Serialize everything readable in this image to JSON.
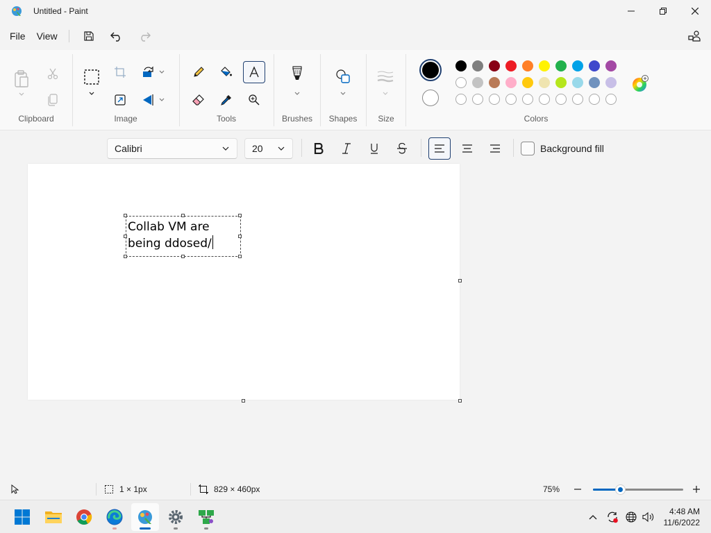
{
  "window": {
    "title": "Untitled - Paint"
  },
  "menu": {
    "file": "File",
    "view": "View"
  },
  "ribbon": {
    "groups": {
      "clipboard": "Clipboard",
      "image": "Image",
      "tools": "Tools",
      "brushes": "Brushes",
      "shapes": "Shapes",
      "size": "Size",
      "colors": "Colors"
    },
    "palette": {
      "row1": [
        "#000000",
        "#7f7f7f",
        "#880015",
        "#ed1c24",
        "#ff7f27",
        "#fff200",
        "#22b14c",
        "#00a2e8",
        "#3f48cc",
        "#a349a4"
      ],
      "row2": [
        "#ffffff",
        "#c3c3c3",
        "#b97a57",
        "#ffaec9",
        "#ffc90e",
        "#efe4b0",
        "#b5e61d",
        "#99d9ea",
        "#7092be",
        "#c8bfe7"
      ],
      "row3_empty_count": 10,
      "primary": "#000000",
      "secondary": "#ffffff"
    }
  },
  "text_toolbar": {
    "font": "Calibri",
    "size": "20",
    "background_fill_label": "Background fill"
  },
  "canvas": {
    "text_line1": "Collab VM are",
    "text_line2": "being ddosed/"
  },
  "status": {
    "selection": "1 × 1px",
    "canvas_size": "829 × 460px",
    "zoom": "75%",
    "zoom_level": 0.3
  },
  "taskbar": {
    "time": "4:48 AM",
    "date": "11/6/2022"
  }
}
